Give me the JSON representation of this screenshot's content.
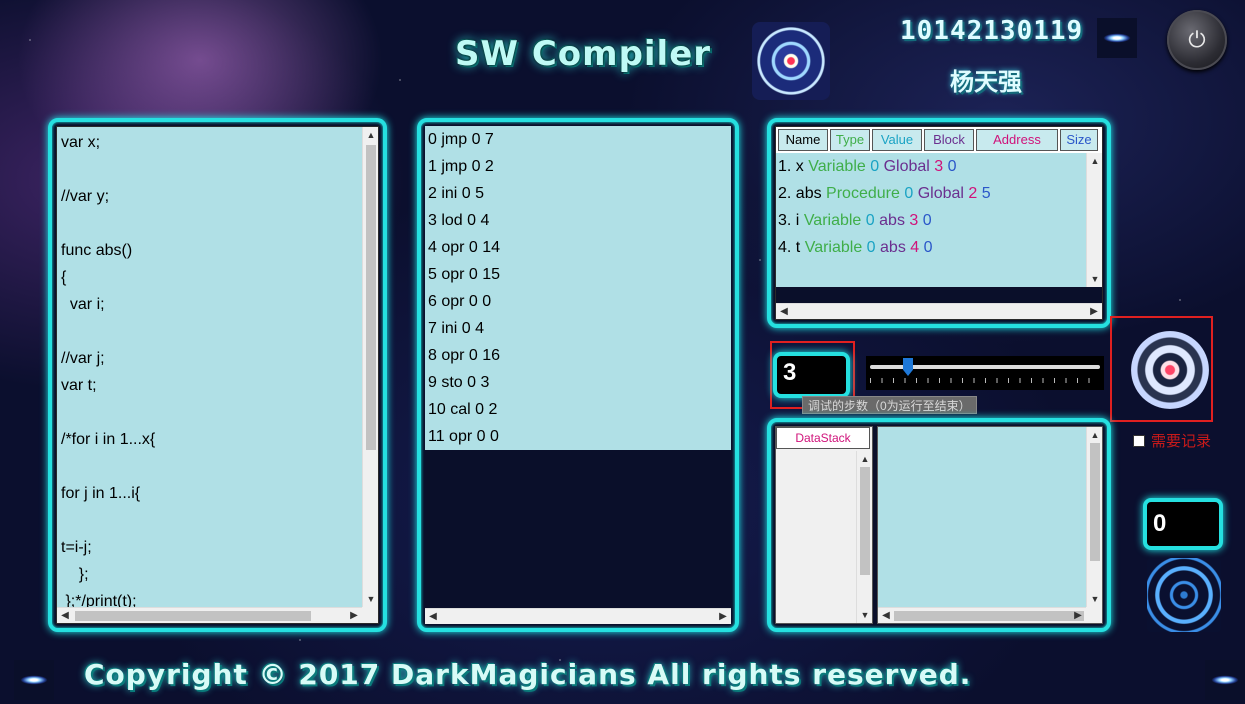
{
  "header": {
    "title": "SW Compiler",
    "student_id": "10142130119",
    "student_name": "杨天强"
  },
  "source_code": {
    "lines": [
      "var x;",
      "",
      "//var y;",
      "",
      "func abs()",
      "{",
      "  var i;",
      "",
      "//var j;",
      "var t;",
      "",
      "/*for i in 1...x{",
      "",
      "for j in 1...i{",
      "",
      "t=i-j;",
      "    };",
      " };*/print(t);"
    ]
  },
  "instructions": {
    "items": [
      "0 jmp 0 7",
      "1 jmp 0 2",
      "2 ini 0 5",
      "3 lod 0 4",
      "4 opr 0 14",
      "5 opr 0 15",
      "6 opr 0 0",
      "7 ini 0 4",
      "8 opr 0 16",
      "9 sto 0 3",
      "10 cal 0 2",
      "11 opr 0 0"
    ]
  },
  "symbol_table": {
    "headers": [
      "Name",
      "Type",
      "Value",
      "Block",
      "Address",
      "Size"
    ],
    "rows": [
      {
        "index": "1.",
        "name": "x",
        "type": "Variable",
        "value": "0",
        "block": "Global",
        "address": "3",
        "size": "0"
      },
      {
        "index": "2.",
        "name": "abs",
        "type": "Procedure",
        "value": "0",
        "block": "Global",
        "address": "2",
        "size": "5"
      },
      {
        "index": "3.",
        "name": "i",
        "type": "Variable",
        "value": "0",
        "block": "abs",
        "address": "3",
        "size": "0"
      },
      {
        "index": "4.",
        "name": "t",
        "type": "Variable",
        "value": "0",
        "block": "abs",
        "address": "4",
        "size": "0"
      }
    ],
    "colors": {
      "name": "#000000",
      "type": "#3fae49",
      "value": "#1aa3c4",
      "block": "#6b2f8f",
      "address": "#d0127a",
      "size": "#2b57c9"
    }
  },
  "debug": {
    "step_value": "3",
    "tooltip": "调试的步数（0为运行至结束）",
    "slider_position": 0.15,
    "record_label": "需要记录",
    "record_checked": false,
    "counter": "0"
  },
  "data_stack": {
    "tab_label": "DataStack"
  },
  "footer": {
    "copyright": "Copyright © 2017 DarkMagicians All rights reserved."
  }
}
